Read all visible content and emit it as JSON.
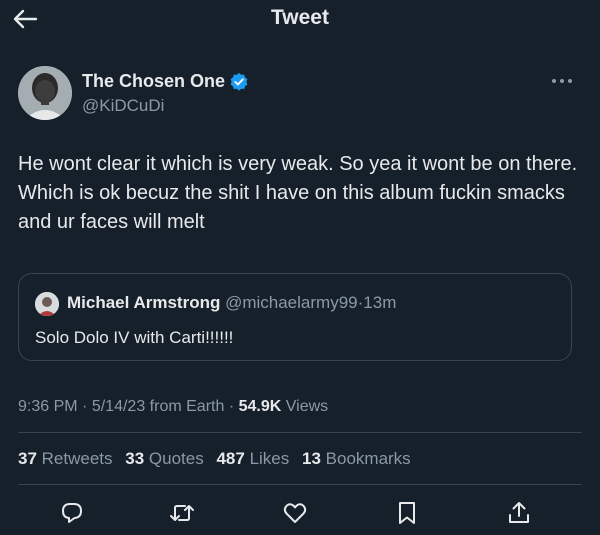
{
  "header": {
    "title": "Tweet",
    "back_icon": "arrow-left-icon"
  },
  "author": {
    "name": "The Chosen One",
    "handle": "@KiDCuDi",
    "verified": true,
    "verified_color": "#1d9bf0"
  },
  "tweet": {
    "text": "He wont clear it which is very weak.  So yea it wont be on there.  Which is ok becuz the shit I have on this album fuckin smacks and ur faces will melt"
  },
  "quote": {
    "name": "Michael Armstrong",
    "handle": "@michaelarmy99",
    "separator": "·",
    "time": "13m",
    "text": "Solo Dolo IV with Carti!!!!!!"
  },
  "meta": {
    "time": "9:36 PM",
    "sep1": "·",
    "date": "5/14/23",
    "source": "from Earth",
    "sep2": "·",
    "views_count": "54.9K",
    "views_label": "Views"
  },
  "stats": [
    {
      "count": "37",
      "label": "Retweets"
    },
    {
      "count": "33",
      "label": "Quotes"
    },
    {
      "count": "487",
      "label": "Likes"
    },
    {
      "count": "13",
      "label": "Bookmarks"
    }
  ],
  "actions": [
    "reply-icon",
    "retweet-icon",
    "like-icon",
    "bookmark-icon",
    "share-icon"
  ],
  "colors": {
    "background": "#15202b",
    "text": "#e7e9ea",
    "muted": "#8b98a5",
    "border": "#38444d"
  }
}
